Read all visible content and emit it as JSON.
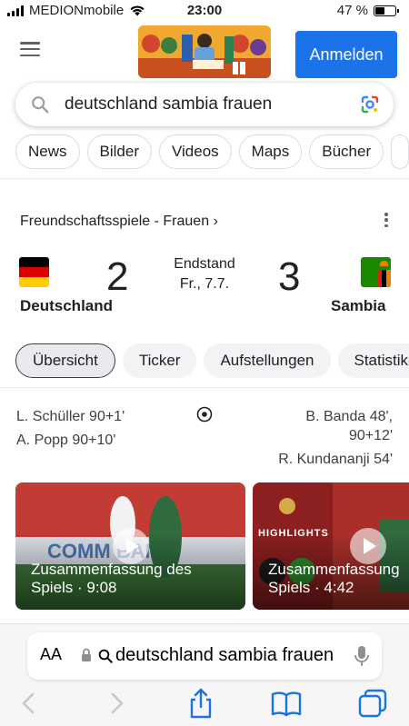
{
  "status_bar": {
    "carrier": "MEDIONmobile",
    "time": "23:00",
    "battery_percent": "47 %",
    "battery_level": 0.47
  },
  "header": {
    "menu_icon": "hamburger-menu-icon",
    "logo": "google-doodle",
    "signin_label": "Anmelden"
  },
  "search": {
    "query": "deutschland sambia frauen",
    "search_icon": "search-icon",
    "lens_icon": "google-lens-icon"
  },
  "chips": [
    "News",
    "Bilder",
    "Videos",
    "Maps",
    "Bücher"
  ],
  "match": {
    "league": "Freundschaftsspiele - Frauen",
    "league_chevron": "›",
    "home_team": "Deutschland",
    "home_score": "2",
    "away_team": "Sambia",
    "away_score": "3",
    "status": "Endstand",
    "date": "Fr., 7.7.",
    "tabs": [
      "Übersicht",
      "Ticker",
      "Aufstellungen",
      "Statistiken"
    ],
    "active_tab": "Übersicht",
    "home_scorers": [
      "L. Schüller 90+1'",
      "A. Popp 90+10'"
    ],
    "away_scorers": [
      "B. Banda 48',",
      "90+12'",
      "R. Kundananji 54'"
    ],
    "goal_icon": "soccer-ball-icon"
  },
  "videos": [
    {
      "title_line1": "Zusammenfassung des",
      "title_line2": "Spiels · 9:08"
    },
    {
      "title_line1": "Zusammenfassung",
      "title_line2": "Spiels · 4:42",
      "overlay_label": "HIGHLIGHTS"
    }
  ],
  "browser": {
    "aa_label": "AA",
    "url_text": "deutschland sambia frauen",
    "back_icon": "chevron-left-icon",
    "forward_icon": "chevron-right-icon",
    "share_icon": "share-icon",
    "bookmarks_icon": "book-icon",
    "tabs_icon": "tabs-icon"
  },
  "colors": {
    "accent": "#1a73e8",
    "text": "#202124"
  }
}
